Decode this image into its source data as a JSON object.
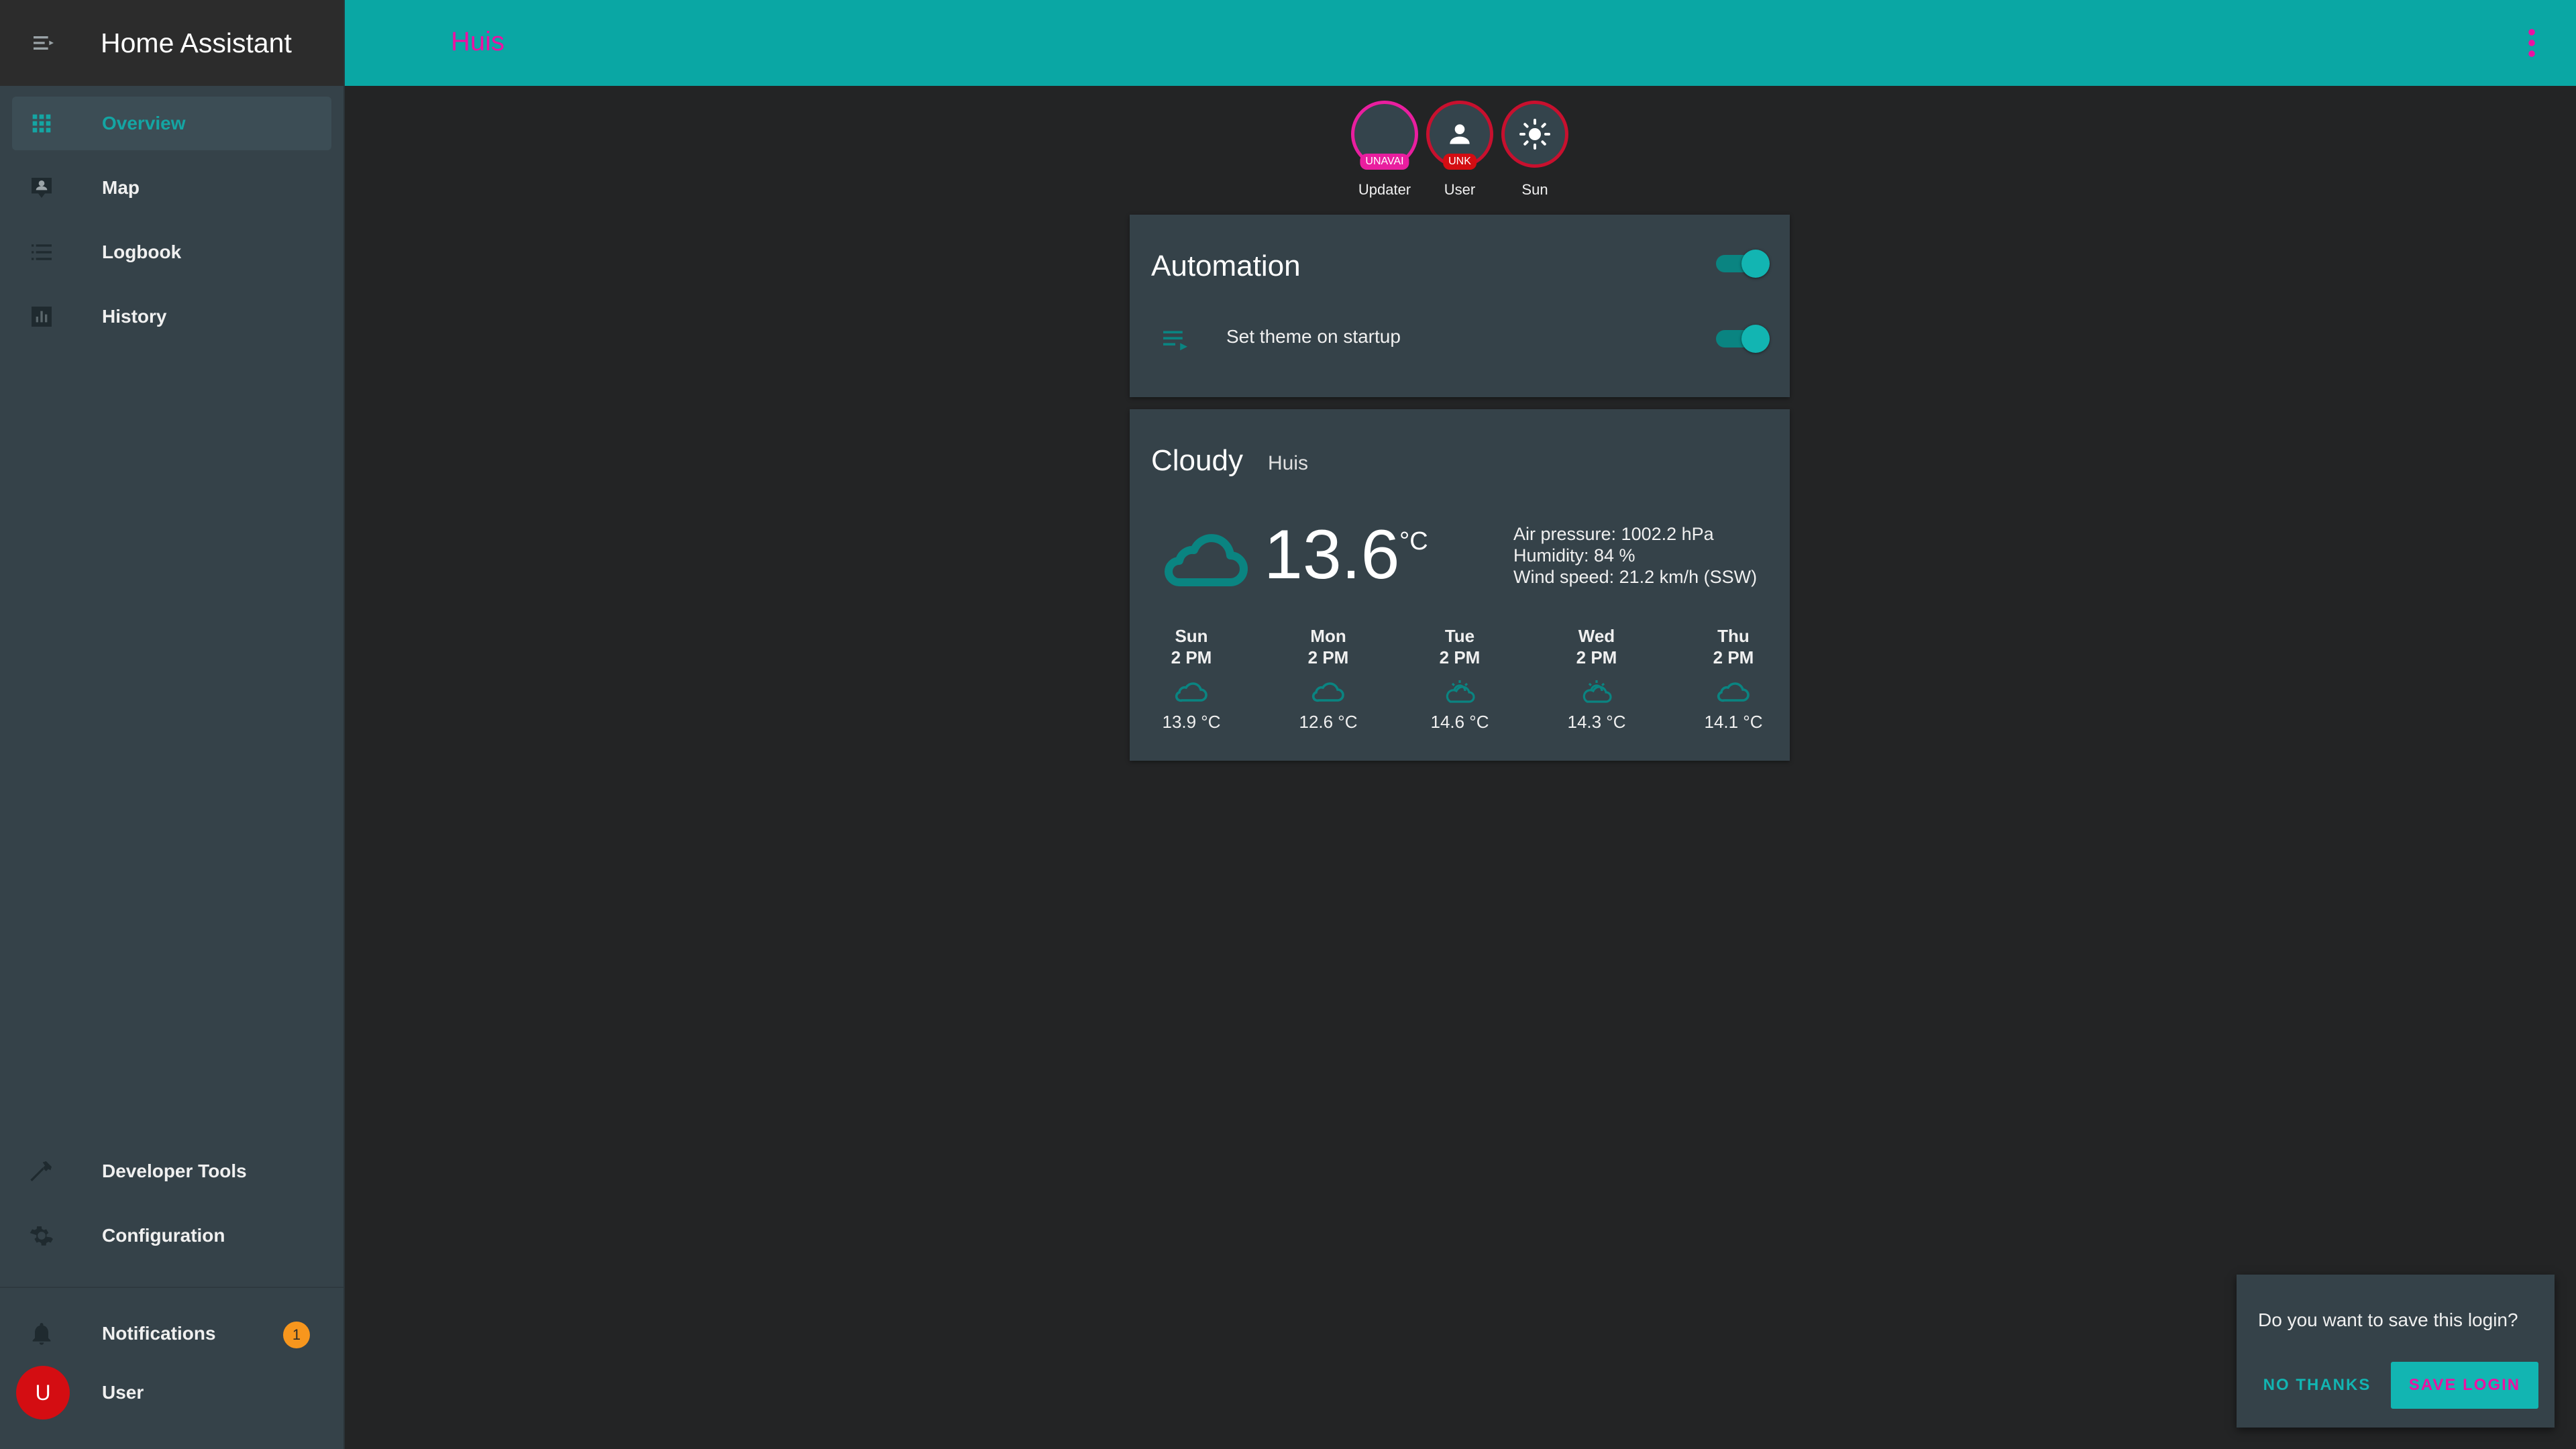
{
  "sidebar": {
    "title": "Home Assistant",
    "items": [
      {
        "label": "Overview"
      },
      {
        "label": "Map"
      },
      {
        "label": "Logbook"
      },
      {
        "label": "History"
      }
    ],
    "bottom_items": [
      {
        "label": "Developer Tools"
      },
      {
        "label": "Configuration"
      }
    ],
    "notifications": {
      "label": "Notifications",
      "count": "1"
    },
    "user": {
      "label": "User",
      "initial": "U"
    }
  },
  "topbar": {
    "title": "Huis"
  },
  "badges": [
    {
      "label": "Updater",
      "tag": "UNAVAI"
    },
    {
      "label": "User",
      "tag": "UNK"
    },
    {
      "label": "Sun"
    }
  ],
  "automation_card": {
    "title": "Automation",
    "row_label": "Set theme on startup"
  },
  "weather_card": {
    "condition": "Cloudy",
    "name": "Huis",
    "temperature": "13.6",
    "unit": "°C",
    "attributes": {
      "pressure": "Air pressure: 1002.2 hPa",
      "humidity": "Humidity: 84 %",
      "wind": "Wind speed: 21.2 km/h (SSW)"
    },
    "forecast": [
      {
        "day": "Sun",
        "time": "2 PM",
        "temp": "13.9 °C",
        "icon": "cloudy-icon"
      },
      {
        "day": "Mon",
        "time": "2 PM",
        "temp": "12.6 °C",
        "icon": "cloudy-icon"
      },
      {
        "day": "Tue",
        "time": "2 PM",
        "temp": "14.6 °C",
        "icon": "partly-cloudy-icon"
      },
      {
        "day": "Wed",
        "time": "2 PM",
        "temp": "14.3 °C",
        "icon": "partly-cloudy-icon"
      },
      {
        "day": "Thu",
        "time": "2 PM",
        "temp": "14.1 °C",
        "icon": "cloudy-icon"
      }
    ]
  },
  "toast": {
    "message": "Do you want to save this login?",
    "no_label": "NO THANKS",
    "save_label": "SAVE LOGIN"
  },
  "colors": {
    "primary": "#0aa7a4",
    "accent": "#ec11a2",
    "sidebar": "#354249",
    "background": "#232425",
    "badge_orange": "#f7961d",
    "user_red": "#d40d12"
  }
}
